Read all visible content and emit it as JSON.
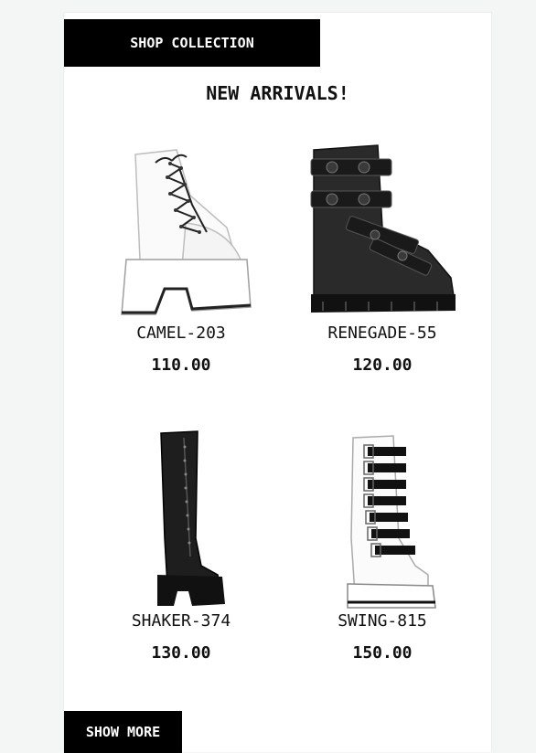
{
  "header": {
    "shop_label": "SHOP COLLECTION",
    "headline": "NEW ARRIVALS!"
  },
  "products": [
    {
      "name": "CAMEL-203",
      "price": "110.00",
      "image_icon": "white-platform-ankle-boot"
    },
    {
      "name": "RENEGADE-55",
      "price": "120.00",
      "image_icon": "black-strapped-combat-boot"
    },
    {
      "name": "SHAKER-374",
      "price": "130.00",
      "image_icon": "black-thigh-high-platform-boot"
    },
    {
      "name": "SWING-815",
      "price": "150.00",
      "image_icon": "white-buckle-knee-boot"
    }
  ],
  "footer": {
    "more_label": "SHOW MORE"
  },
  "colors": {
    "button_bg": "#000000",
    "button_text": "#ffffff",
    "page_bg": "#f4f5f5",
    "card_bg": "#ffffff"
  }
}
